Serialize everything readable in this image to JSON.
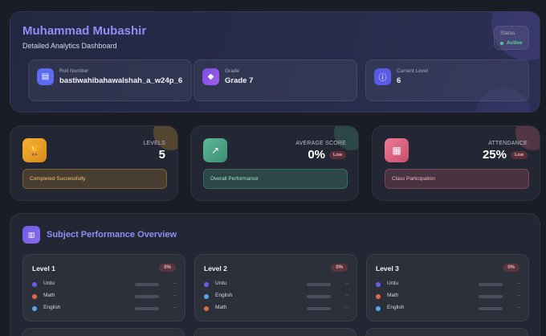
{
  "header": {
    "name": "Muhammad Mubashir",
    "subtitle": "Detailed Analytics Dashboard",
    "status_label": "Status",
    "status_value": "Active",
    "info": [
      {
        "label": "Roll Number",
        "value": "bastiwahibahawalshah_a_w24p_6",
        "icon": "id-card-icon",
        "color": "#5b6cf0"
      },
      {
        "label": "Grade",
        "value": "Grade 7",
        "icon": "graduation-cap-icon",
        "color": "#8b55e8"
      },
      {
        "label": "Current Level",
        "value": "6",
        "icon": "info-icon",
        "color": "#5a5ce6"
      }
    ]
  },
  "stats": [
    {
      "label": "LEVELS",
      "value": "5",
      "badge": "",
      "bar": "Completed Successfully",
      "icon": "trophy-icon",
      "color": "#e7a12a"
    },
    {
      "label": "AVERAGE SCORE",
      "value": "0%",
      "badge": "Low",
      "bar": "Overall Performance",
      "icon": "chart-icon",
      "color": "#4aa588"
    },
    {
      "label": "ATTENDANCE",
      "value": "25%",
      "badge": "Low",
      "bar": "Class Participation",
      "icon": "calendar-icon",
      "color": "#e0627e"
    }
  ],
  "subjects": {
    "title": "Subject Performance Overview",
    "levels": [
      {
        "title": "Level 1",
        "percent": "0%",
        "rows": [
          {
            "name": "Urdu",
            "value": "--",
            "color": "#6b5be8"
          },
          {
            "name": "Math",
            "value": "--",
            "color": "#e06a44"
          },
          {
            "name": "English",
            "value": "--",
            "color": "#5ea2ee"
          }
        ]
      },
      {
        "title": "Level 2",
        "percent": "0%",
        "rows": [
          {
            "name": "Urdu",
            "value": "--",
            "color": "#6b5be8"
          },
          {
            "name": "English",
            "value": "--",
            "color": "#5ea2ee"
          },
          {
            "name": "Math",
            "value": "--",
            "color": "#e06a44"
          }
        ]
      },
      {
        "title": "Level 3",
        "percent": "0%",
        "rows": [
          {
            "name": "Urdu",
            "value": "--",
            "color": "#6b5be8"
          },
          {
            "name": "Math",
            "value": "--",
            "color": "#e06a44"
          },
          {
            "name": "English",
            "value": "--",
            "color": "#5ea2ee"
          }
        ]
      }
    ]
  }
}
